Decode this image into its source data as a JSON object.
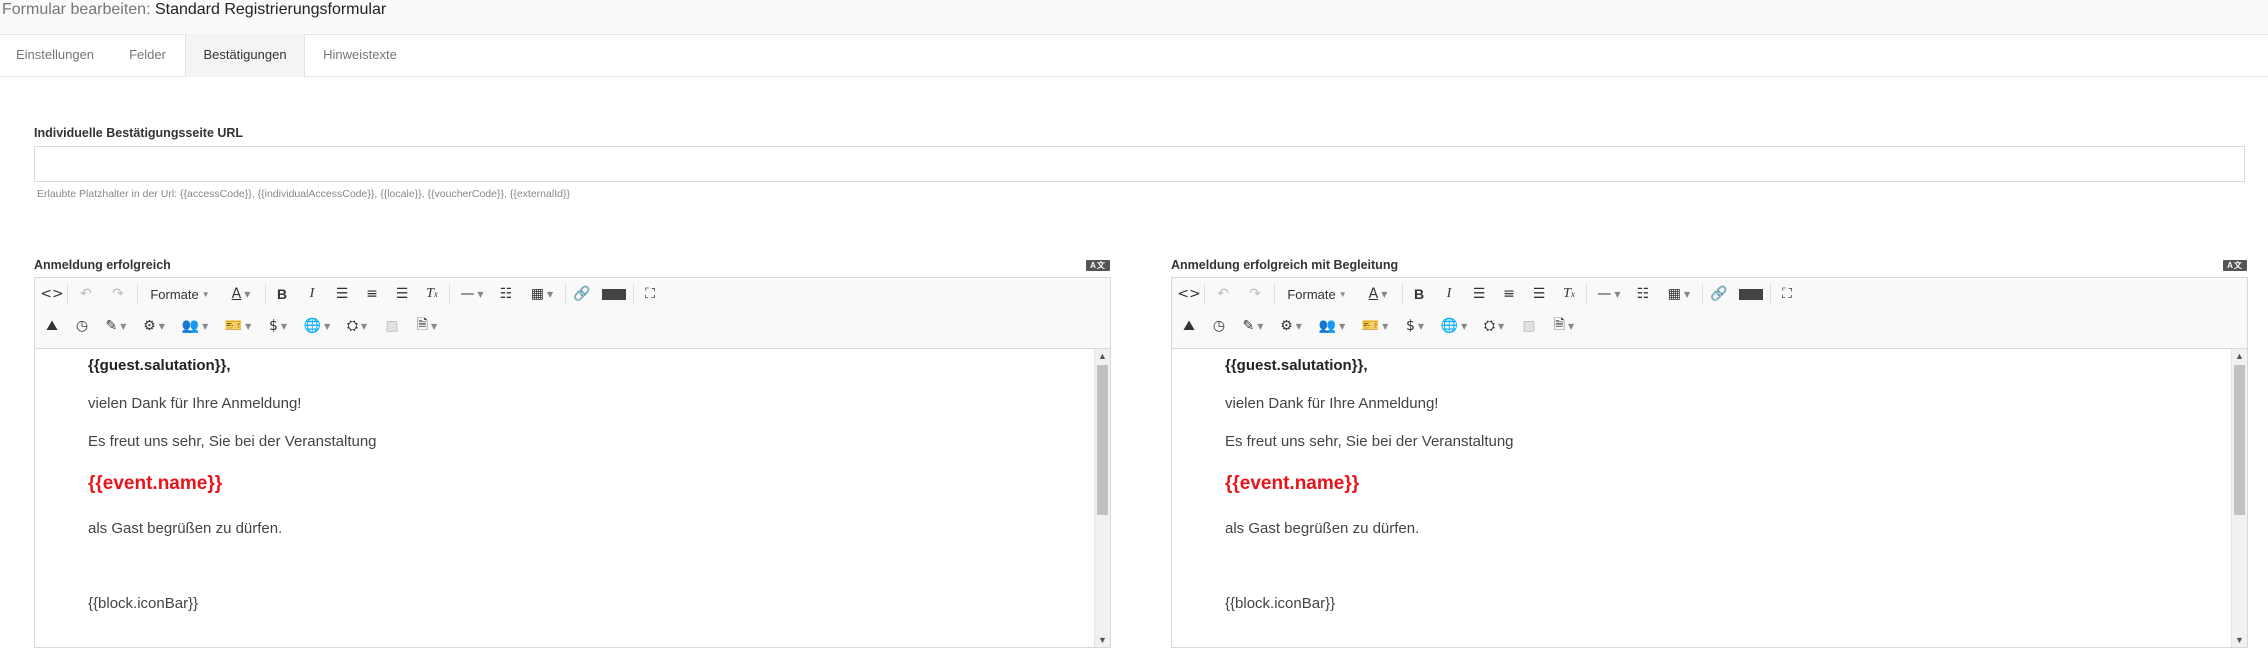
{
  "header": {
    "prefix": "Formular bearbeiten: ",
    "title": "Standard Registrierungsformular"
  },
  "tabs": [
    {
      "label": "Einstellungen"
    },
    {
      "label": "Felder"
    },
    {
      "label": "Bestätigungen",
      "active": true
    },
    {
      "label": "Hinweistexte"
    }
  ],
  "url_field": {
    "label": "Individuelle Bestätigungsseite URL",
    "value": "",
    "hint": "Erlaubte Platzhalter in der Url: {{accessCode}}, {{individualAccessCode}}, {{locale}}, {{voucherCode}}, {{externalId}}"
  },
  "lang_badge": "A文",
  "toolbar": {
    "formats_label": "Formate"
  },
  "editors": [
    {
      "label": "Anmeldung erfolgreich",
      "lines": {
        "salutation": "{{guest.salutation}},",
        "thanks": "vielen Dank für Ihre Anmeldung!",
        "joy": "Es freut uns sehr, Sie bei der Veranstaltung",
        "event": "{{event.name}}",
        "welcome": "als Gast begrüßen zu dürfen.",
        "iconbar": "{{block.iconBar}}"
      }
    },
    {
      "label": "Anmeldung erfolgreich mit Begleitung",
      "lines": {
        "salutation": "{{guest.salutation}},",
        "thanks": "vielen Dank für Ihre Anmeldung!",
        "joy": "Es freut uns sehr, Sie bei der Veranstaltung",
        "event": "{{event.name}}",
        "welcome": "als Gast begrüßen zu dürfen.",
        "iconbar": "{{block.iconBar}}"
      }
    }
  ],
  "colors": {
    "placeholder_red": "#e8141c"
  }
}
